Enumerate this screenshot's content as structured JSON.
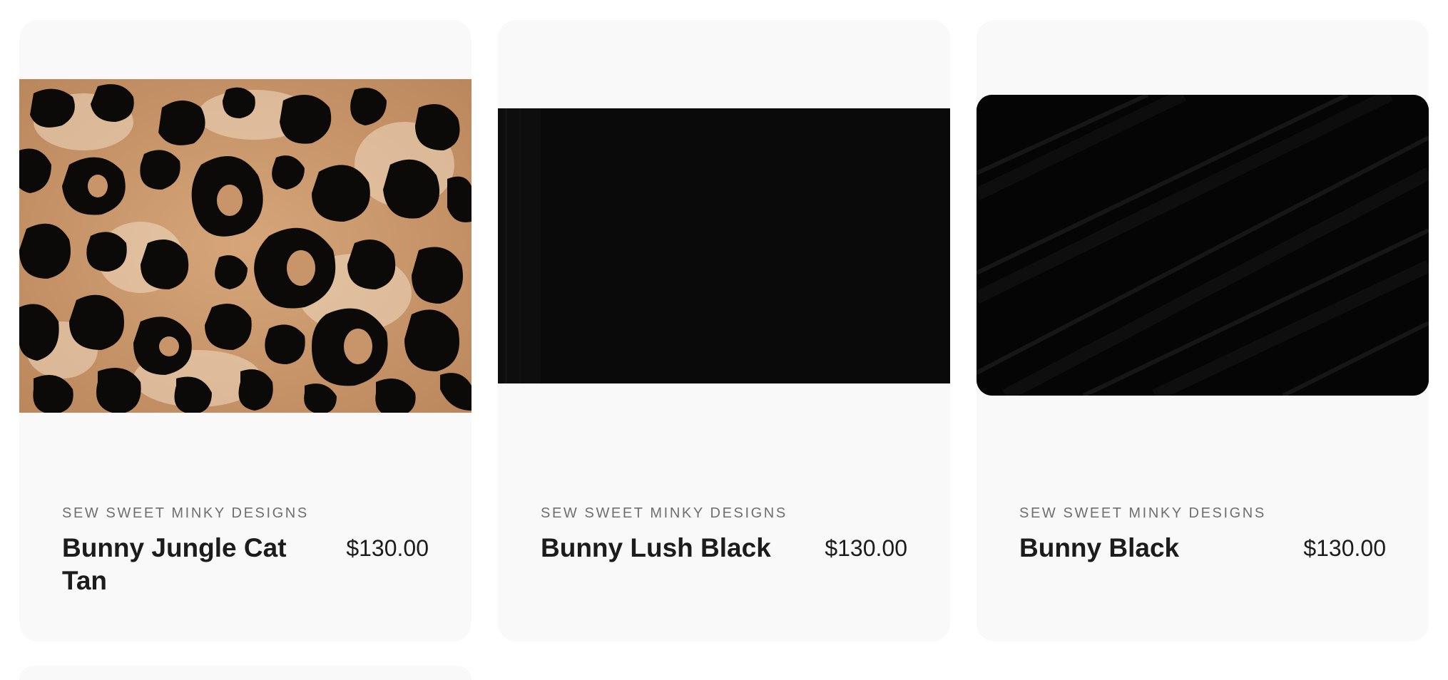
{
  "products": [
    {
      "vendor": "SEW SWEET MINKY DESIGNS",
      "title": "Bunny Jungle Cat Tan",
      "price": "$130.00",
      "image": "leopard-print-fabric"
    },
    {
      "vendor": "SEW SWEET MINKY DESIGNS",
      "title": "Bunny Lush Black",
      "price": "$130.00",
      "image": "black-lush-fabric"
    },
    {
      "vendor": "SEW SWEET MINKY DESIGNS",
      "title": "Bunny Black",
      "price": "$130.00",
      "image": "black-ribbed-fabric"
    }
  ],
  "colors": {
    "card_bg": "#f9f9f9",
    "vendor_text": "#6f6f6f",
    "title_text": "#1c1c1c",
    "leopard_base": "#c8956a",
    "leopard_spot": "#0c0a08"
  }
}
